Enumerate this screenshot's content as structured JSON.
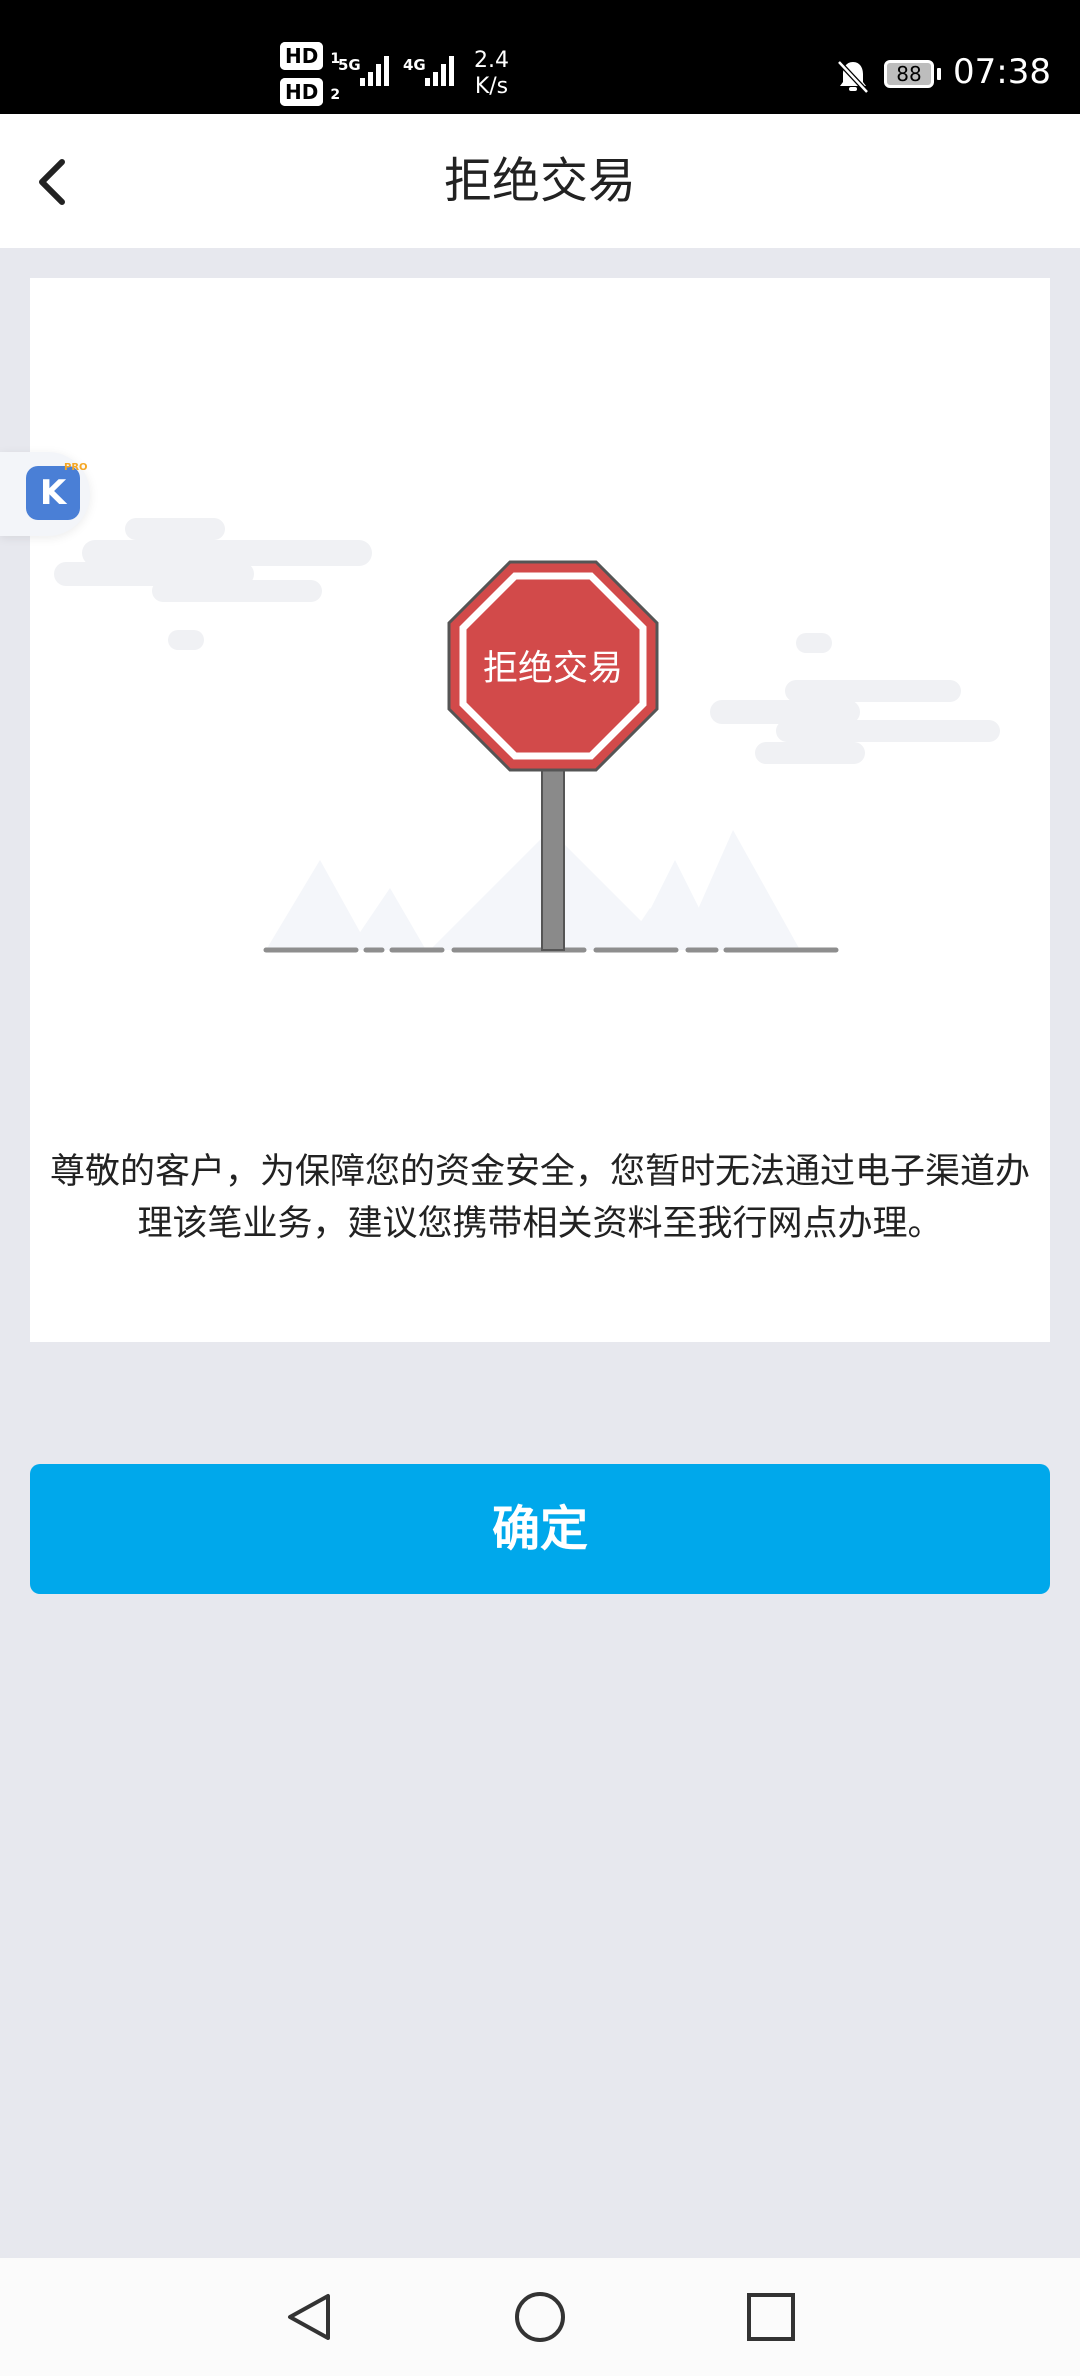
{
  "status_bar": {
    "hd1": "HD",
    "hd1_sub": "1",
    "hd2": "HD",
    "hd2_sub": "2",
    "net1": "5G",
    "net2": "4G",
    "speed_value": "2.4",
    "speed_unit": "K/s",
    "battery": "88",
    "time": "07:38"
  },
  "header": {
    "title": "拒绝交易"
  },
  "illustration": {
    "sign_text": "拒绝交易",
    "sign_color": "#d24a4a"
  },
  "card": {
    "message": "尊敬的客户，为保障您的资金安全，您暂时无法通过电子渠道办理该笔业务，建议您携带相关资料至我行网点办理。"
  },
  "float_widget": {
    "icon_letter": "K",
    "badge": "PRO"
  },
  "actions": {
    "confirm_label": "确定",
    "confirm_color": "#00a8eb"
  }
}
